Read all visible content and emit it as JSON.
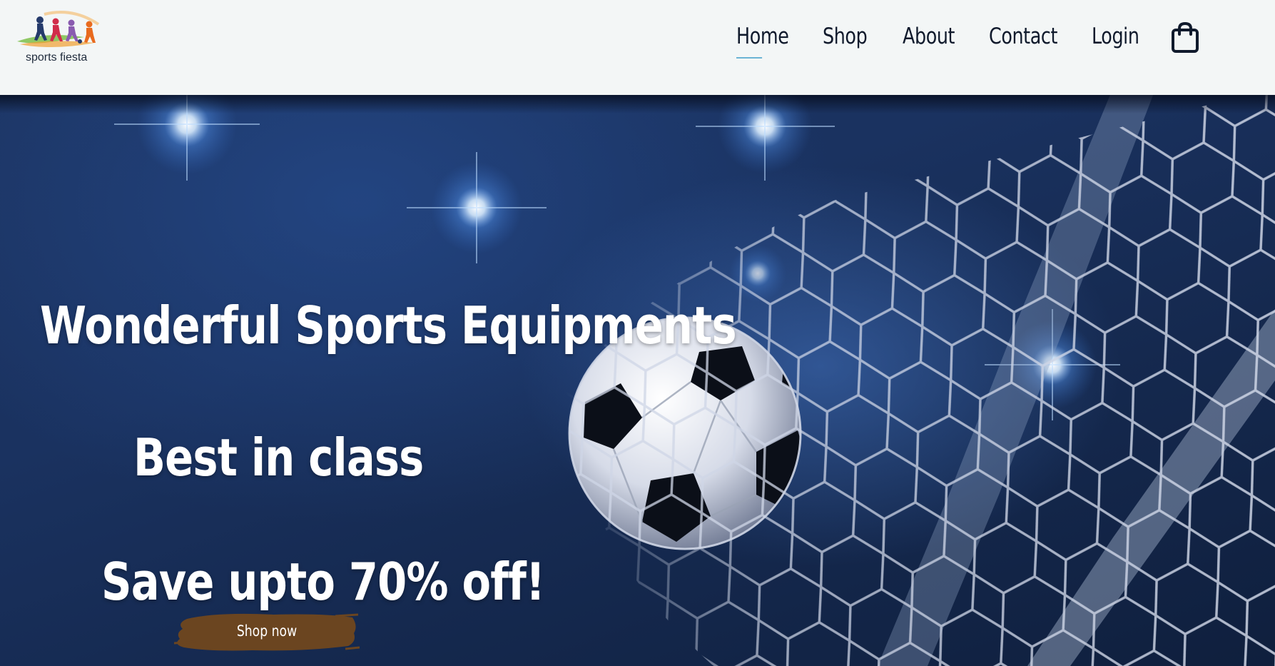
{
  "brand": {
    "name": "sports fiesta"
  },
  "nav": {
    "items": [
      {
        "label": "Home",
        "active": true
      },
      {
        "label": "Shop",
        "active": false
      },
      {
        "label": "About",
        "active": false
      },
      {
        "label": "Contact",
        "active": false
      },
      {
        "label": "Login",
        "active": false
      }
    ],
    "cart_icon": "shopping-bag-icon"
  },
  "hero": {
    "title": "Wonderful Sports Equipments",
    "tagline": "Best in class",
    "offer": "Save upto 70% off!",
    "cta_label": "Shop now",
    "image": "soccer-ball-in-goal-net"
  },
  "colors": {
    "header_bg": "#f3f6f6",
    "nav_text": "#101a2c",
    "nav_active_underline": "#6bb4d4",
    "hero_bg": "#1a3260",
    "hero_text": "#ffffff",
    "cta_bg": "#6b4520"
  }
}
